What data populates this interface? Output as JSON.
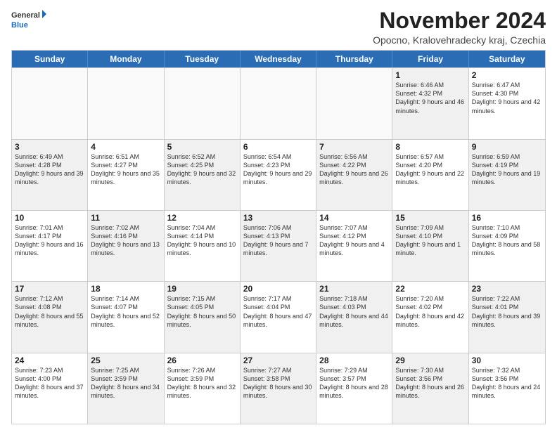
{
  "logo": {
    "line1": "General",
    "line2": "Blue"
  },
  "title": "November 2024",
  "subtitle": "Opocno, Kralovehradecky kraj, Czechia",
  "header_days": [
    "Sunday",
    "Monday",
    "Tuesday",
    "Wednesday",
    "Thursday",
    "Friday",
    "Saturday"
  ],
  "rows": [
    [
      {
        "day": "",
        "text": "",
        "empty": true
      },
      {
        "day": "",
        "text": "",
        "empty": true
      },
      {
        "day": "",
        "text": "",
        "empty": true
      },
      {
        "day": "",
        "text": "",
        "empty": true
      },
      {
        "day": "",
        "text": "",
        "empty": true
      },
      {
        "day": "1",
        "text": "Sunrise: 6:46 AM\nSunset: 4:32 PM\nDaylight: 9 hours and 46 minutes.",
        "shaded": true
      },
      {
        "day": "2",
        "text": "Sunrise: 6:47 AM\nSunset: 4:30 PM\nDaylight: 9 hours and 42 minutes.",
        "shaded": false
      }
    ],
    [
      {
        "day": "3",
        "text": "Sunrise: 6:49 AM\nSunset: 4:28 PM\nDaylight: 9 hours and 39 minutes.",
        "shaded": true
      },
      {
        "day": "4",
        "text": "Sunrise: 6:51 AM\nSunset: 4:27 PM\nDaylight: 9 hours and 35 minutes.",
        "shaded": false
      },
      {
        "day": "5",
        "text": "Sunrise: 6:52 AM\nSunset: 4:25 PM\nDaylight: 9 hours and 32 minutes.",
        "shaded": true
      },
      {
        "day": "6",
        "text": "Sunrise: 6:54 AM\nSunset: 4:23 PM\nDaylight: 9 hours and 29 minutes.",
        "shaded": false
      },
      {
        "day": "7",
        "text": "Sunrise: 6:56 AM\nSunset: 4:22 PM\nDaylight: 9 hours and 26 minutes.",
        "shaded": true
      },
      {
        "day": "8",
        "text": "Sunrise: 6:57 AM\nSunset: 4:20 PM\nDaylight: 9 hours and 22 minutes.",
        "shaded": false
      },
      {
        "day": "9",
        "text": "Sunrise: 6:59 AM\nSunset: 4:19 PM\nDaylight: 9 hours and 19 minutes.",
        "shaded": true
      }
    ],
    [
      {
        "day": "10",
        "text": "Sunrise: 7:01 AM\nSunset: 4:17 PM\nDaylight: 9 hours and 16 minutes.",
        "shaded": false
      },
      {
        "day": "11",
        "text": "Sunrise: 7:02 AM\nSunset: 4:16 PM\nDaylight: 9 hours and 13 minutes.",
        "shaded": true
      },
      {
        "day": "12",
        "text": "Sunrise: 7:04 AM\nSunset: 4:14 PM\nDaylight: 9 hours and 10 minutes.",
        "shaded": false
      },
      {
        "day": "13",
        "text": "Sunrise: 7:06 AM\nSunset: 4:13 PM\nDaylight: 9 hours and 7 minutes.",
        "shaded": true
      },
      {
        "day": "14",
        "text": "Sunrise: 7:07 AM\nSunset: 4:12 PM\nDaylight: 9 hours and 4 minutes.",
        "shaded": false
      },
      {
        "day": "15",
        "text": "Sunrise: 7:09 AM\nSunset: 4:10 PM\nDaylight: 9 hours and 1 minute.",
        "shaded": true
      },
      {
        "day": "16",
        "text": "Sunrise: 7:10 AM\nSunset: 4:09 PM\nDaylight: 8 hours and 58 minutes.",
        "shaded": false
      }
    ],
    [
      {
        "day": "17",
        "text": "Sunrise: 7:12 AM\nSunset: 4:08 PM\nDaylight: 8 hours and 55 minutes.",
        "shaded": true
      },
      {
        "day": "18",
        "text": "Sunrise: 7:14 AM\nSunset: 4:07 PM\nDaylight: 8 hours and 52 minutes.",
        "shaded": false
      },
      {
        "day": "19",
        "text": "Sunrise: 7:15 AM\nSunset: 4:05 PM\nDaylight: 8 hours and 50 minutes.",
        "shaded": true
      },
      {
        "day": "20",
        "text": "Sunrise: 7:17 AM\nSunset: 4:04 PM\nDaylight: 8 hours and 47 minutes.",
        "shaded": false
      },
      {
        "day": "21",
        "text": "Sunrise: 7:18 AM\nSunset: 4:03 PM\nDaylight: 8 hours and 44 minutes.",
        "shaded": true
      },
      {
        "day": "22",
        "text": "Sunrise: 7:20 AM\nSunset: 4:02 PM\nDaylight: 8 hours and 42 minutes.",
        "shaded": false
      },
      {
        "day": "23",
        "text": "Sunrise: 7:22 AM\nSunset: 4:01 PM\nDaylight: 8 hours and 39 minutes.",
        "shaded": true
      }
    ],
    [
      {
        "day": "24",
        "text": "Sunrise: 7:23 AM\nSunset: 4:00 PM\nDaylight: 8 hours and 37 minutes.",
        "shaded": false
      },
      {
        "day": "25",
        "text": "Sunrise: 7:25 AM\nSunset: 3:59 PM\nDaylight: 8 hours and 34 minutes.",
        "shaded": true
      },
      {
        "day": "26",
        "text": "Sunrise: 7:26 AM\nSunset: 3:59 PM\nDaylight: 8 hours and 32 minutes.",
        "shaded": false
      },
      {
        "day": "27",
        "text": "Sunrise: 7:27 AM\nSunset: 3:58 PM\nDaylight: 8 hours and 30 minutes.",
        "shaded": true
      },
      {
        "day": "28",
        "text": "Sunrise: 7:29 AM\nSunset: 3:57 PM\nDaylight: 8 hours and 28 minutes.",
        "shaded": false
      },
      {
        "day": "29",
        "text": "Sunrise: 7:30 AM\nSunset: 3:56 PM\nDaylight: 8 hours and 26 minutes.",
        "shaded": true
      },
      {
        "day": "30",
        "text": "Sunrise: 7:32 AM\nSunset: 3:56 PM\nDaylight: 8 hours and 24 minutes.",
        "shaded": false
      }
    ]
  ]
}
